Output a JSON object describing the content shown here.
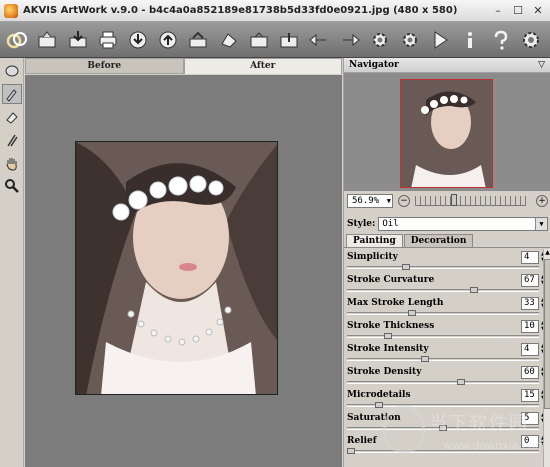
{
  "window": {
    "title": "AKVIS ArtWork v.9.0 - b4c4a0a852189e81738b5d33fd0e0921.jpg (480 x 580)",
    "minimize": "–",
    "maximize": "☐",
    "close": "✕"
  },
  "toolbar": {
    "buttons": [
      {
        "name": "logo"
      },
      {
        "name": "open"
      },
      {
        "name": "save"
      },
      {
        "name": "print"
      },
      {
        "name": "import-preset"
      },
      {
        "name": "export-preset"
      },
      {
        "name": "batch"
      },
      {
        "name": "share"
      },
      {
        "name": "share-2"
      },
      {
        "name": "undo"
      },
      {
        "name": "redo"
      },
      {
        "name": "settings"
      },
      {
        "name": "settings-2"
      },
      {
        "name": "run"
      },
      {
        "name": "info"
      },
      {
        "name": "help"
      },
      {
        "name": "preferences"
      }
    ]
  },
  "canvas": {
    "tabs": [
      "Before",
      "After"
    ],
    "active_tab": "After"
  },
  "navigator": {
    "title": "Navigator",
    "zoom": "56.9%"
  },
  "settings": {
    "style_label": "Style:",
    "style_value": "Oil",
    "tabs": [
      "Painting",
      "Decoration"
    ],
    "active_tab": "Painting",
    "params": [
      {
        "label": "Simplicity",
        "value": "4",
        "level": 0.3
      },
      {
        "label": "Stroke Curvature",
        "value": "67",
        "level": 0.67
      },
      {
        "label": "Max Stroke Length",
        "value": "33",
        "level": 0.33
      },
      {
        "label": "Stroke Thickness",
        "value": "10",
        "level": 0.2
      },
      {
        "label": "Stroke Intensity",
        "value": "4",
        "level": 0.4
      },
      {
        "label": "Stroke Density",
        "value": "60",
        "level": 0.6
      },
      {
        "label": "Microdetails",
        "value": "15",
        "level": 0.15
      },
      {
        "label": "Saturation",
        "value": "5",
        "level": 0.5
      },
      {
        "label": "Relief",
        "value": "0",
        "level": 0.0
      }
    ]
  },
  "watermark": {
    "text": "当下软件园",
    "url": "www.downxia.com"
  }
}
